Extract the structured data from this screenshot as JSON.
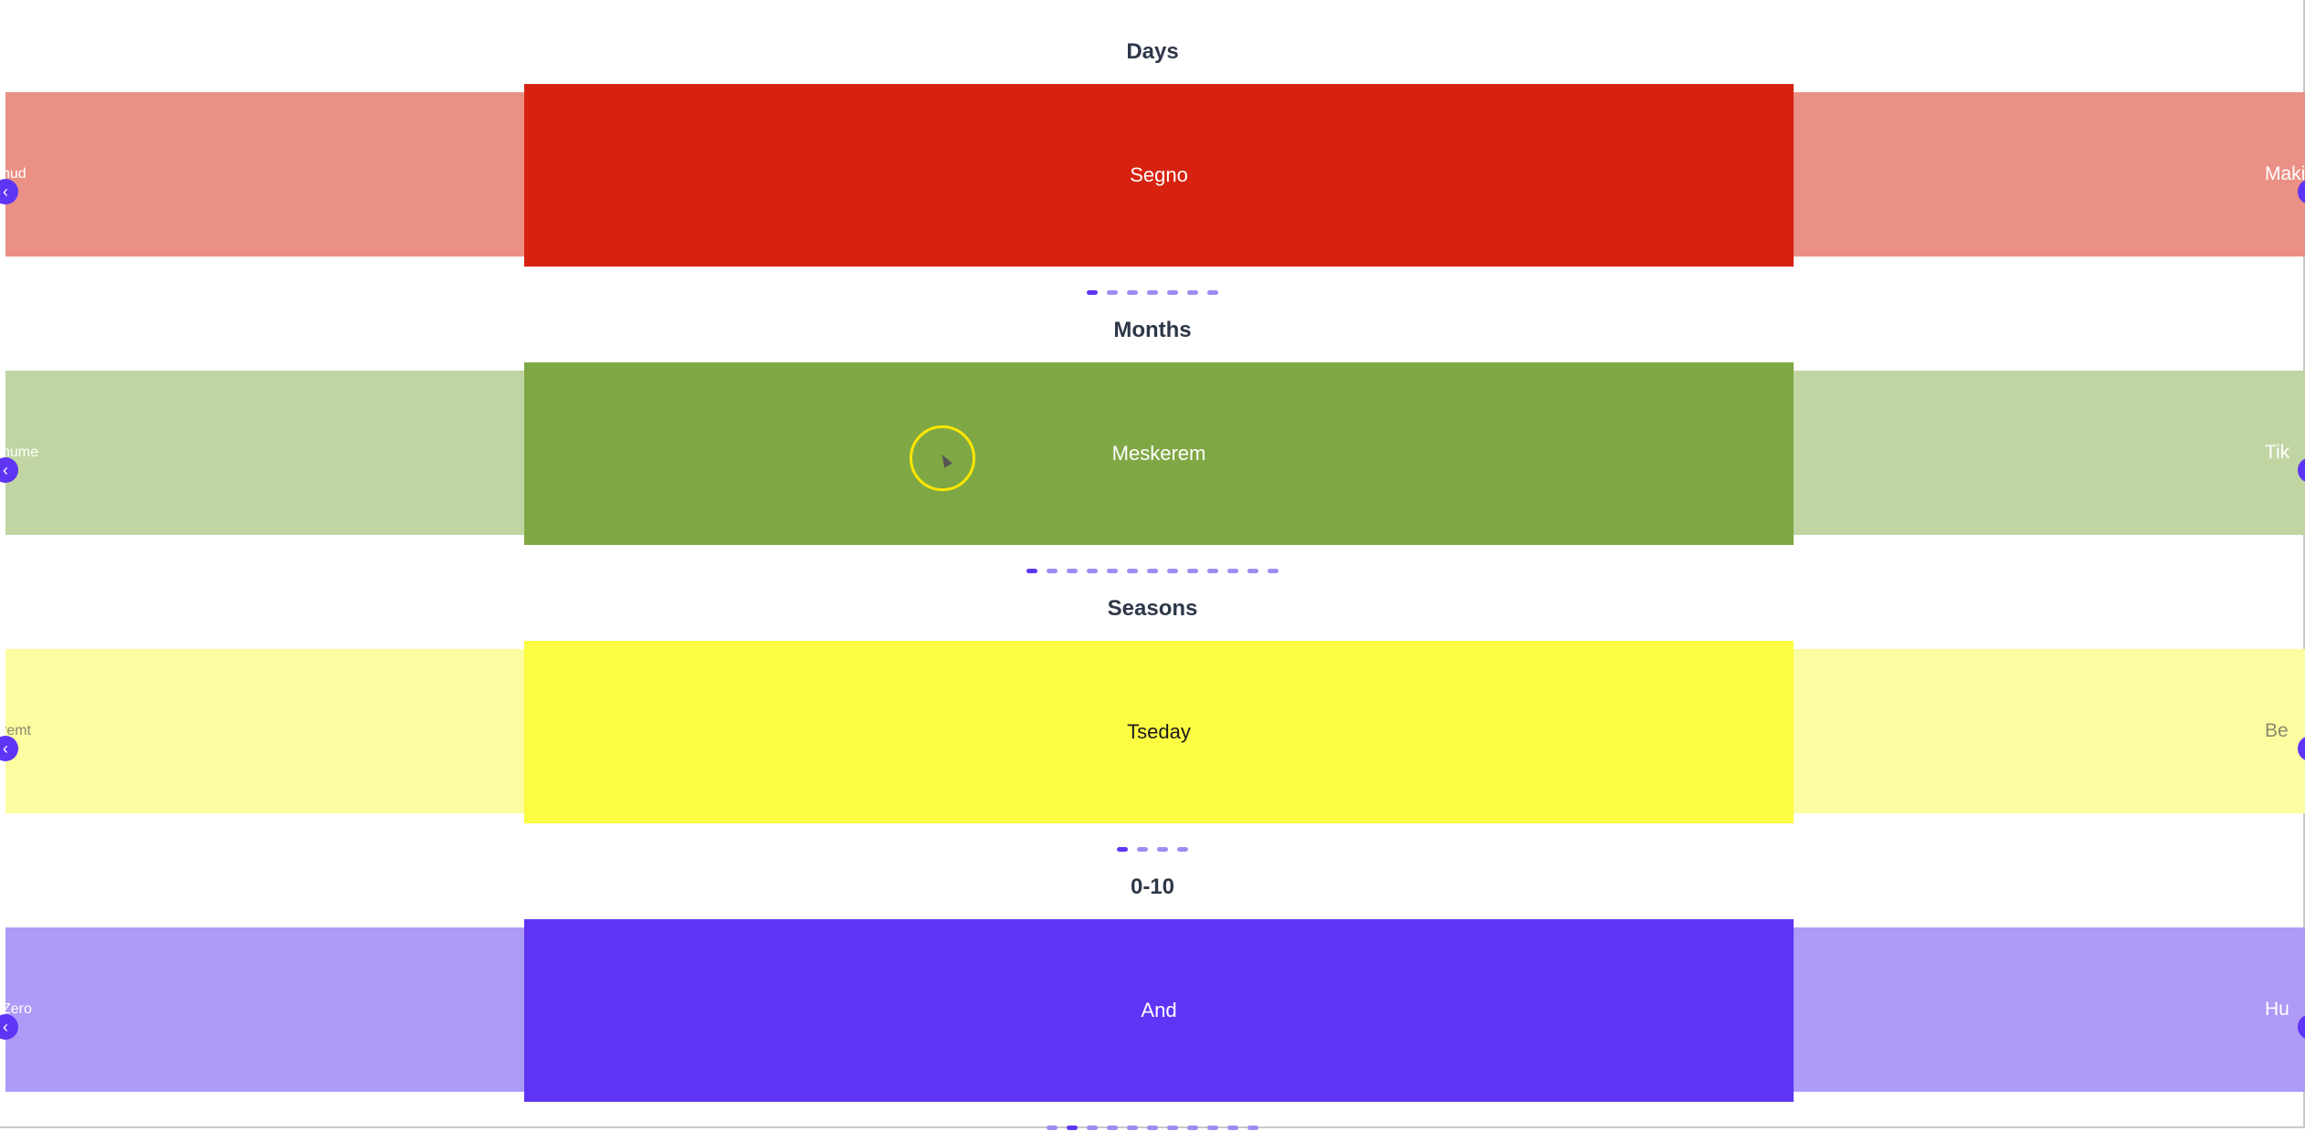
{
  "colors": {
    "accent": "#5f35f5",
    "dot_inactive": "#9d8cf2",
    "cursor_ring": "#ffe600"
  },
  "icons": {
    "prev": "chevron-left-icon",
    "next": "chevron-right-icon"
  },
  "carousels": [
    {
      "title": "Days",
      "prev_label": "hud",
      "active_label": "Segno",
      "next_label": "Makis",
      "colors": {
        "active": "#d6220f",
        "side": "#ea9085",
        "text": "#ffffff",
        "side_text": "#ffffff"
      },
      "dot_count": 7,
      "active_dot": 0
    },
    {
      "title": "Months",
      "prev_label": "hume",
      "active_label": "Meskerem",
      "next_label": "Tik",
      "colors": {
        "active": "#7fa845",
        "side": "#c1d5a2",
        "text": "#ffffff",
        "side_text": "#ffffff"
      },
      "dot_count": 13,
      "active_dot": 0
    },
    {
      "title": "Seasons",
      "prev_label": "remt",
      "active_label": "Tseday",
      "next_label": "Be",
      "colors": {
        "active": "#fcfc42",
        "side": "#fcfca0",
        "text": "#1a1a1a",
        "side_text": "#8a8a70"
      },
      "dot_count": 4,
      "active_dot": 0
    },
    {
      "title": "0-10",
      "prev_label": "Zero",
      "active_label": "And",
      "next_label": "Hu",
      "colors": {
        "active": "#5f35f5",
        "side": "#ae9af7",
        "text": "#ffffff",
        "side_text": "#ffffff"
      },
      "dot_count": 11,
      "active_dot": 1
    }
  ]
}
